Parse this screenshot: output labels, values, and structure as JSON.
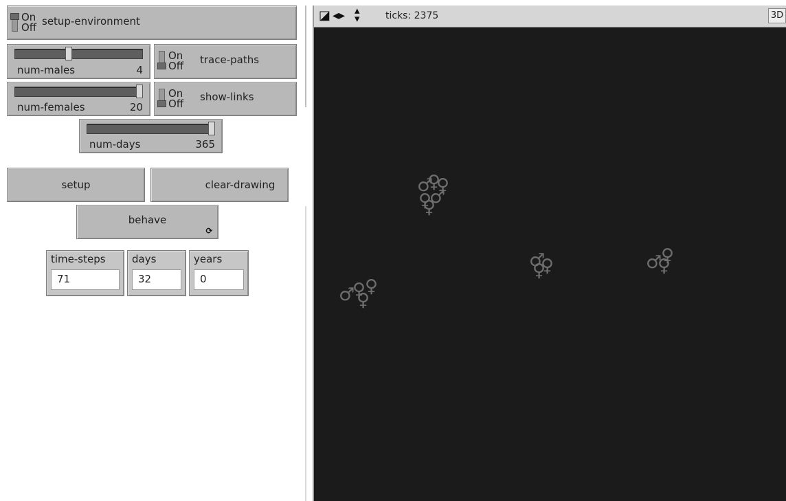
{
  "switches": {
    "setup_environment": {
      "on": "On",
      "off": "Off",
      "label": "setup-environment"
    },
    "trace_paths": {
      "on": "On",
      "off": "Off",
      "label": "trace-paths"
    },
    "show_links": {
      "on": "On",
      "off": "Off",
      "label": "show-links"
    }
  },
  "sliders": {
    "num_males": {
      "label": "num-males",
      "value": "4",
      "fraction": 0.42
    },
    "num_females": {
      "label": "num-females",
      "value": "20",
      "fraction": 1.0
    },
    "num_days": {
      "label": "num-days",
      "value": "365",
      "fraction": 1.0
    }
  },
  "buttons": {
    "setup": "setup",
    "clear_drawing": "clear-drawing",
    "behave": "behave"
  },
  "monitors": {
    "time_steps": {
      "label": "time-steps",
      "value": "71"
    },
    "days": {
      "label": "days",
      "value": "32"
    },
    "years": {
      "label": "years",
      "value": "0"
    }
  },
  "view": {
    "ticks_label": "ticks: 2375",
    "three_d_label": "3D",
    "background_color": "#1b1b1b",
    "agent_color": "#6e6e6e",
    "male_symbol": "♂",
    "female_symbol": "♀",
    "controls": [
      "shape-icon",
      "left-right-arrows-icon",
      "up-down-arrows-icon"
    ]
  }
}
